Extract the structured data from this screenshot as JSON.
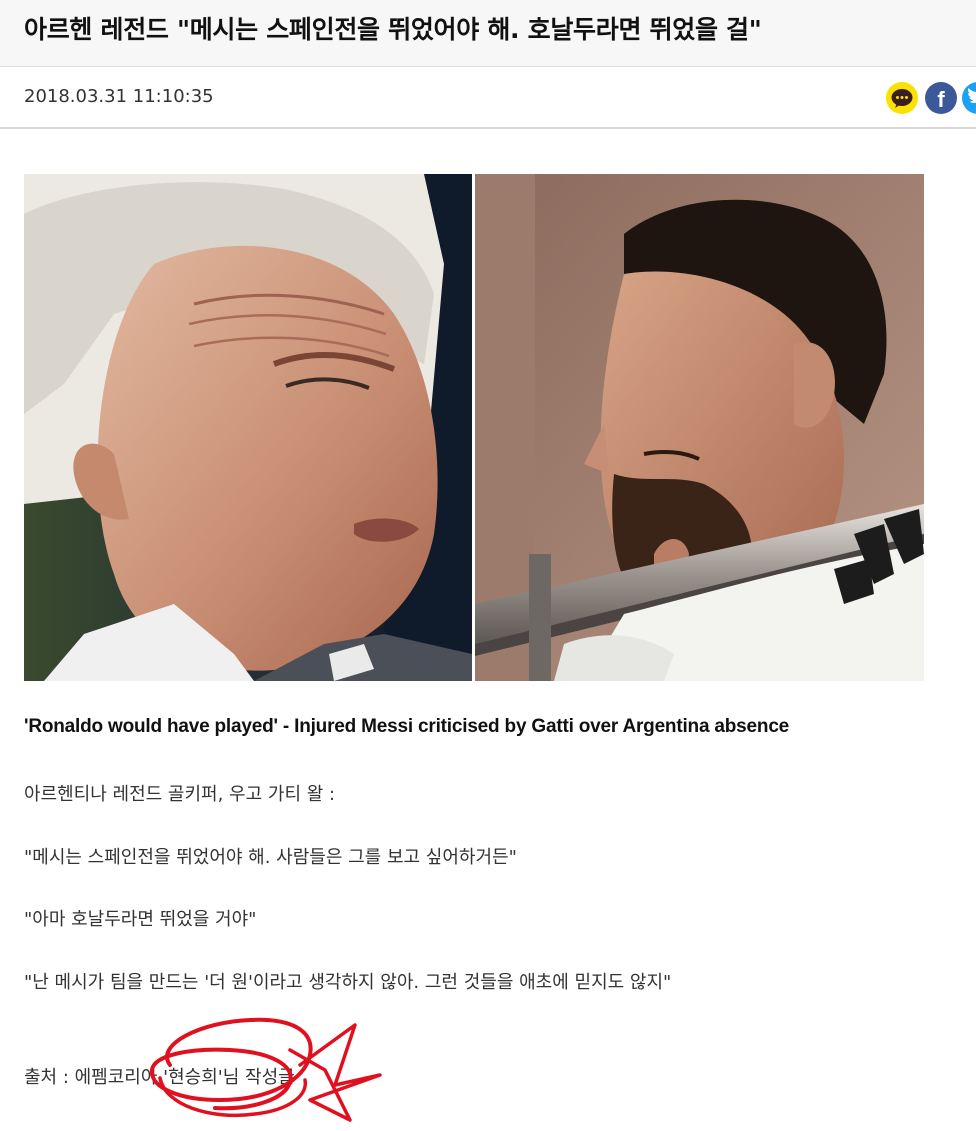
{
  "article": {
    "title": "아르헨 레전드 \"메시는 스페인전을 뛰었어야 해. 호날두라면 뛰었을 걸\"",
    "datetime": "2018.03.31 11:10:35"
  },
  "share": {
    "kakao_icon": "kakao-talk-icon",
    "facebook_icon": "facebook-icon",
    "twitter_icon": "twitter-icon",
    "facebook_glyph": "f"
  },
  "image": {
    "left_subject": "gray-haired older man",
    "right_subject": "bearded man behind railing"
  },
  "body": {
    "caption": "'Ronaldo would have played' - Injured Messi criticised by Gatti over Argentina absence",
    "intro": "아르헨티나 레전드 골키퍼, 우고 가티 왈 :",
    "quote1": "\"메시는 스페인전을 뛰었어야 해. 사람들은 그를 보고 싶어하거든\"",
    "quote2": "\"아마 호날두라면 뛰었을 거야\"",
    "quote3": "\"난 메시가 팀을 만드는 '더 원'이라고 생각하지 않아. 그런 것들을 애초에 믿지도 않지\"",
    "source": "출처 : 에펨코리아 '현승희'님 작성글"
  },
  "colors": {
    "kakao": "#fae100",
    "facebook": "#3b5998",
    "twitter": "#1da1f2",
    "scribble": "#e0101e"
  }
}
